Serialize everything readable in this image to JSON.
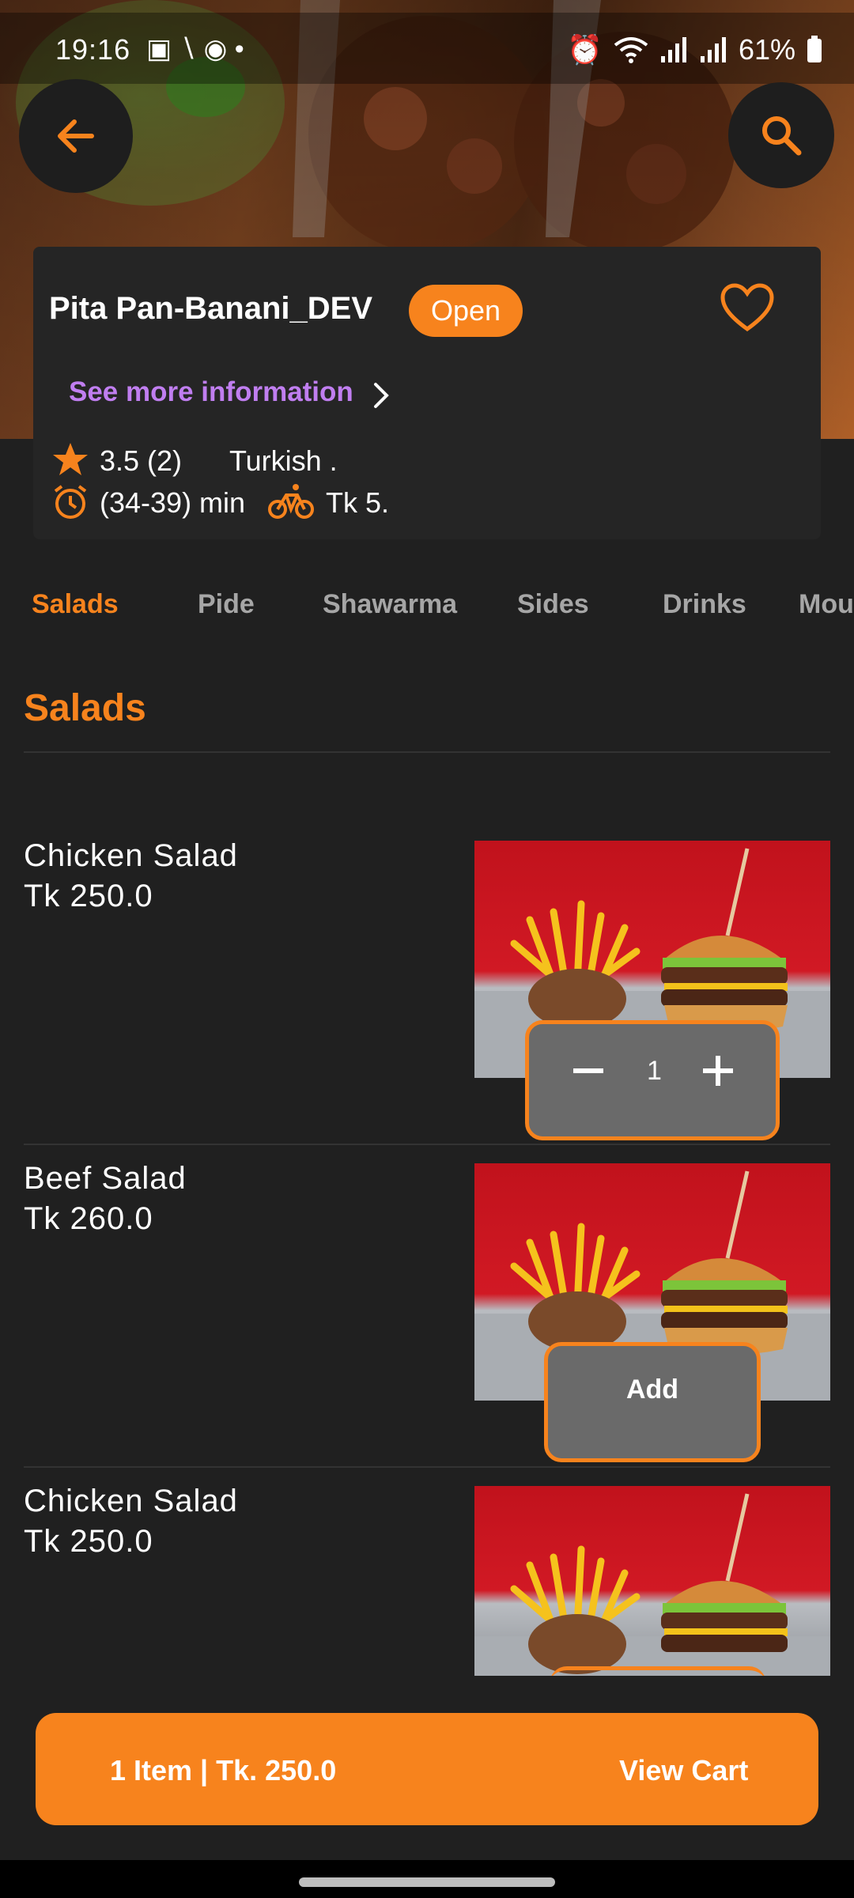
{
  "status_bar": {
    "time": "19:16",
    "battery": "61%"
  },
  "restaurant": {
    "name": "Pita Pan-Banani_DEV",
    "status_badge": "Open",
    "see_more": "See more information",
    "rating": "3.5 (2)",
    "cuisine": "Turkish .",
    "delivery_time": "(34-39) min",
    "delivery_fee": "Tk 5."
  },
  "tabs": [
    "Salads",
    "Pide",
    "Shawarma",
    "Sides",
    "Drinks",
    "Mou"
  ],
  "active_tab": "Salads",
  "section_title": "Salads",
  "menu_items": [
    {
      "name": "Chicken Salad",
      "price": "Tk 250.0",
      "quantity": "1",
      "state": "in-cart"
    },
    {
      "name": "Beef Salad",
      "price": "Tk 260.0",
      "button": "Add",
      "state": "add"
    },
    {
      "name": "Chicken Salad",
      "price": "Tk 250.0",
      "state": "add"
    }
  ],
  "cart": {
    "summary": "1 Item | Tk. 250.0",
    "action": "View Cart"
  },
  "colors": {
    "accent": "#f7831d",
    "background": "#202020",
    "card": "#252525",
    "link": "#c07ef0"
  },
  "icons": [
    "back-arrow-icon",
    "search-icon",
    "heart-icon",
    "chevron-right-icon",
    "star-icon",
    "alarm-clock-icon",
    "bicycle-icon",
    "minus-icon",
    "plus-icon"
  ]
}
